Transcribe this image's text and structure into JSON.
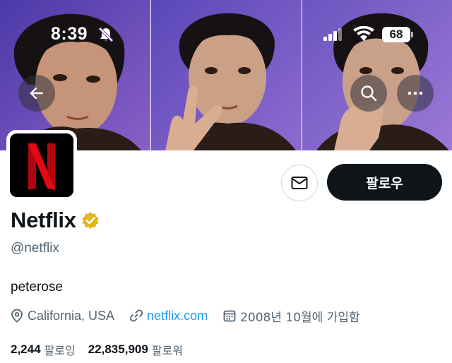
{
  "status_bar": {
    "time": "8:39",
    "battery": "68",
    "icons": [
      "bell-slash-icon",
      "signal-icon",
      "wifi-icon",
      "battery-icon"
    ]
  },
  "header": {
    "icons": [
      "back-arrow-icon",
      "search-icon",
      "more-icon"
    ]
  },
  "profile": {
    "display_name": "Netflix",
    "handle": "@netflix",
    "bio": "peterose",
    "location": "California, USA",
    "website": "netflix.com",
    "joined": "2008년 10월에 가입함",
    "following_count": "2,244",
    "following_label": "팔로잉",
    "followers_count": "22,835,909",
    "followers_label": "팔로워"
  },
  "actions": {
    "follow_label": "팔로우",
    "message_icon": "mail-icon"
  },
  "colors": {
    "accent_link": "#1d9bf0",
    "verified_badge": "#e2b719",
    "netflix_red": "#e50914",
    "follow_button_bg": "#0f1419",
    "secondary_text": "#536471"
  }
}
